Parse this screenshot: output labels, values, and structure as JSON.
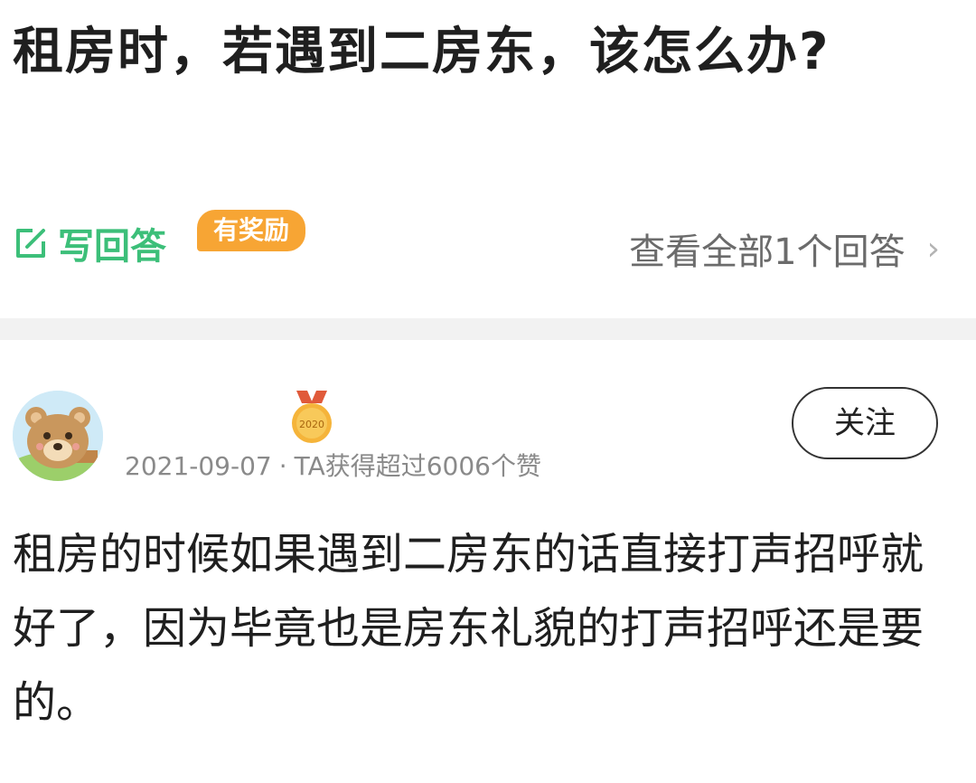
{
  "question": {
    "title": "租房时，若遇到二房东，该怎么办?"
  },
  "actions": {
    "write_answer_label": "写回答",
    "reward_badge": "有奖励",
    "view_all_label": "查看全部1个回答",
    "chevron": "›"
  },
  "answer": {
    "medal_year": "2020",
    "date": "2021-09-07",
    "separator": "·",
    "likes_text": "TA获得超过6006个赞",
    "follow_label": "关注",
    "body": "租房的时候如果遇到二房东的话直接打声招呼就好了，因为毕竟也是房东礼貌的打声招呼还是要的。"
  },
  "colors": {
    "accent_green": "#3cbf79",
    "reward_orange": "#f7a534",
    "meta_gray": "#8a8a8a"
  },
  "icons": {
    "write": "edit-square-icon",
    "medal": "medal-icon",
    "avatar": "bear-avatar"
  }
}
